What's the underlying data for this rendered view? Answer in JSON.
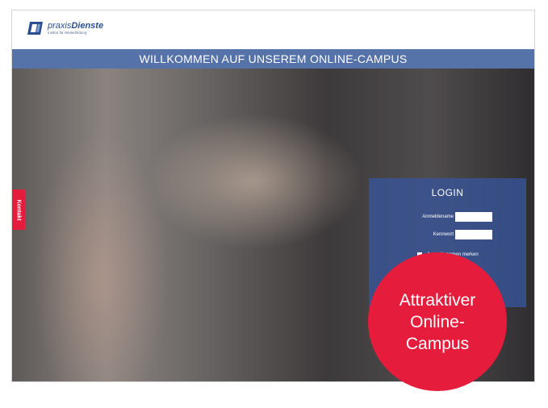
{
  "logo": {
    "brand_prefix": "praxis",
    "brand_main": "Dienste",
    "tagline": "Institut für Weiterbildung",
    "brand_color": "#2b4f8f"
  },
  "banner": {
    "text": "WILLKOMMEN AUF UNSEREM ONLINE-CAMPUS",
    "color": "#5573a8"
  },
  "side_tab": {
    "label": "Kontakt",
    "color": "#e51c3c"
  },
  "login": {
    "title": "LOGIN",
    "username_label": "Anmeldename",
    "password_label": "Kennwort",
    "remember_label": "Anmeldenamen merken",
    "panel_color": "#37559b"
  },
  "badge": {
    "line1": "Attraktiver",
    "line2": "Online-",
    "line3": "Campus",
    "color": "#e51c3c"
  }
}
